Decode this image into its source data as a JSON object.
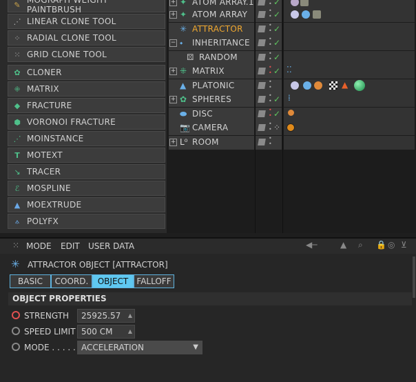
{
  "menu": {
    "items": [
      {
        "label": "MOGRAPH WEIGHT PAINTBRUSH",
        "icon": "paintbrush-icon"
      },
      {
        "label": "LINEAR CLONE TOOL",
        "icon": "linear-clone-icon"
      },
      {
        "label": "RADIAL CLONE TOOL",
        "icon": "radial-clone-icon"
      },
      {
        "label": "GRID CLONE TOOL",
        "icon": "grid-clone-icon"
      },
      {
        "label": "CLONER",
        "icon": "cloner-icon"
      },
      {
        "label": "MATRIX",
        "icon": "matrix-icon"
      },
      {
        "label": "FRACTURE",
        "icon": "fracture-icon"
      },
      {
        "label": "VORONOI FRACTURE",
        "icon": "voronoi-icon"
      },
      {
        "label": "MOINSTANCE",
        "icon": "moinstance-icon"
      },
      {
        "label": "MOTEXT",
        "icon": "motext-icon"
      },
      {
        "label": "TRACER",
        "icon": "tracer-icon"
      },
      {
        "label": "MOSPLINE",
        "icon": "mospline-icon"
      },
      {
        "label": "MOEXTRUDE",
        "icon": "moextrude-icon"
      },
      {
        "label": "POLYFX",
        "icon": "polyfx-icon"
      }
    ]
  },
  "objects": [
    {
      "name": "ATOM ARRAY.1",
      "icon": "atom-array-icon"
    },
    {
      "name": "ATOM ARRAY",
      "icon": "atom-array-icon"
    },
    {
      "name": "ATTRACTOR",
      "icon": "attractor-icon",
      "selected": true
    },
    {
      "name": "INHERITANCE",
      "icon": "inheritance-icon"
    },
    {
      "name": "RANDOM",
      "icon": "random-icon"
    },
    {
      "name": "MATRIX",
      "icon": "matrix-icon"
    },
    {
      "name": "PLATONIC",
      "icon": "platonic-icon"
    },
    {
      "name": "SPHERES",
      "icon": "spheres-icon"
    },
    {
      "name": "DISC",
      "icon": "disc-icon"
    },
    {
      "name": "CAMERA",
      "icon": "camera-icon"
    },
    {
      "name": "ROOM",
      "icon": "room-icon"
    }
  ],
  "attr": {
    "menu": {
      "mode": "MODE",
      "edit": "EDIT",
      "user_data": "USER DATA"
    },
    "title": "ATTRACTOR OBJECT [ATTRACTOR]",
    "tabs": {
      "basic": "BASIC",
      "coord": "COORD.",
      "object": "OBJECT",
      "falloff": "FALLOFF"
    },
    "section": "OBJECT PROPERTIES",
    "strength": {
      "label": "STRENGTH",
      "value": "25925.57"
    },
    "speed_limit": {
      "label": "SPEED LIMIT",
      "value": "500 CM"
    },
    "mode": {
      "label": "MODE . . . . .",
      "value": "ACCELERATION"
    }
  },
  "colors": {
    "accent": "#5fc8f0",
    "selected_text": "#f0a830",
    "check": "#5fc35f"
  }
}
